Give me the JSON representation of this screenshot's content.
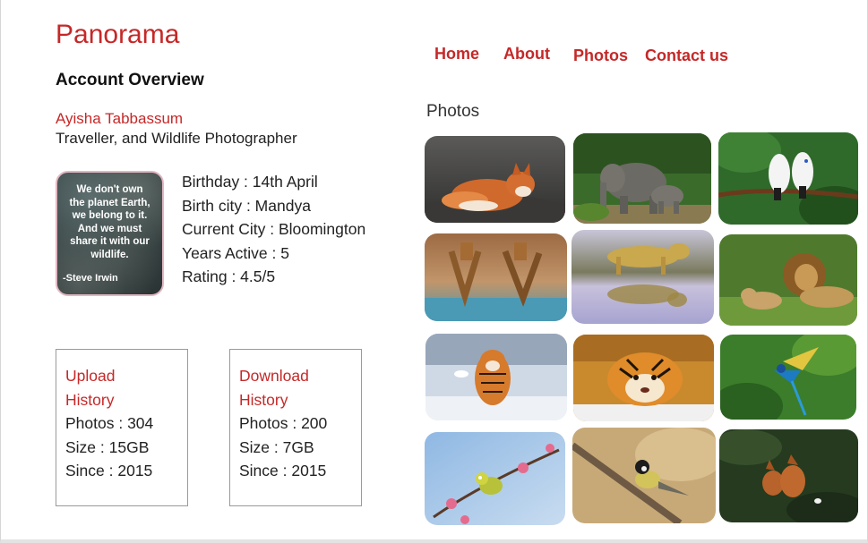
{
  "brand": "Panorama",
  "nav": [
    {
      "label": "Home"
    },
    {
      "label": "About"
    },
    {
      "label": "Photos"
    },
    {
      "label": "Contact us"
    }
  ],
  "account": {
    "heading": "Account Overview",
    "name": "Ayisha Tabbassum",
    "role": "Traveller, and Wildlife Photographer",
    "avatar": {
      "quote_lines": [
        "We don't own",
        "the planet Earth,",
        "we belong to it.",
        "And we must",
        "share it with our",
        "wildlife."
      ],
      "author": "-Steve Irwin"
    },
    "details": [
      "Birthday : 14th April",
      "Birth city : Mandya",
      "Current City : Bloomington",
      "Years Active : 5",
      "Rating : 4.5/5"
    ]
  },
  "upload": {
    "title_lines": [
      "Upload",
      "History"
    ],
    "rows": [
      "Photos : 304",
      "Size : 15GB",
      "Since : 2015"
    ]
  },
  "download": {
    "title_lines": [
      "Download",
      "History"
    ],
    "rows": [
      "Photos : 200",
      "Size : 7GB",
      "Since : 2015"
    ]
  },
  "photos": {
    "heading": "Photos",
    "items": [
      {
        "subject": "fox"
      },
      {
        "subject": "elephants"
      },
      {
        "subject": "white-birds"
      },
      {
        "subject": "giraffes"
      },
      {
        "subject": "leopard"
      },
      {
        "subject": "lions"
      },
      {
        "subject": "tiger-snow"
      },
      {
        "subject": "tiger-lying"
      },
      {
        "subject": "bird-flight"
      },
      {
        "subject": "bird-blossom"
      },
      {
        "subject": "bird-branch"
      },
      {
        "subject": "foxes"
      }
    ]
  },
  "colors": {
    "accent": "#c62828",
    "border": "#9a9a9a"
  }
}
